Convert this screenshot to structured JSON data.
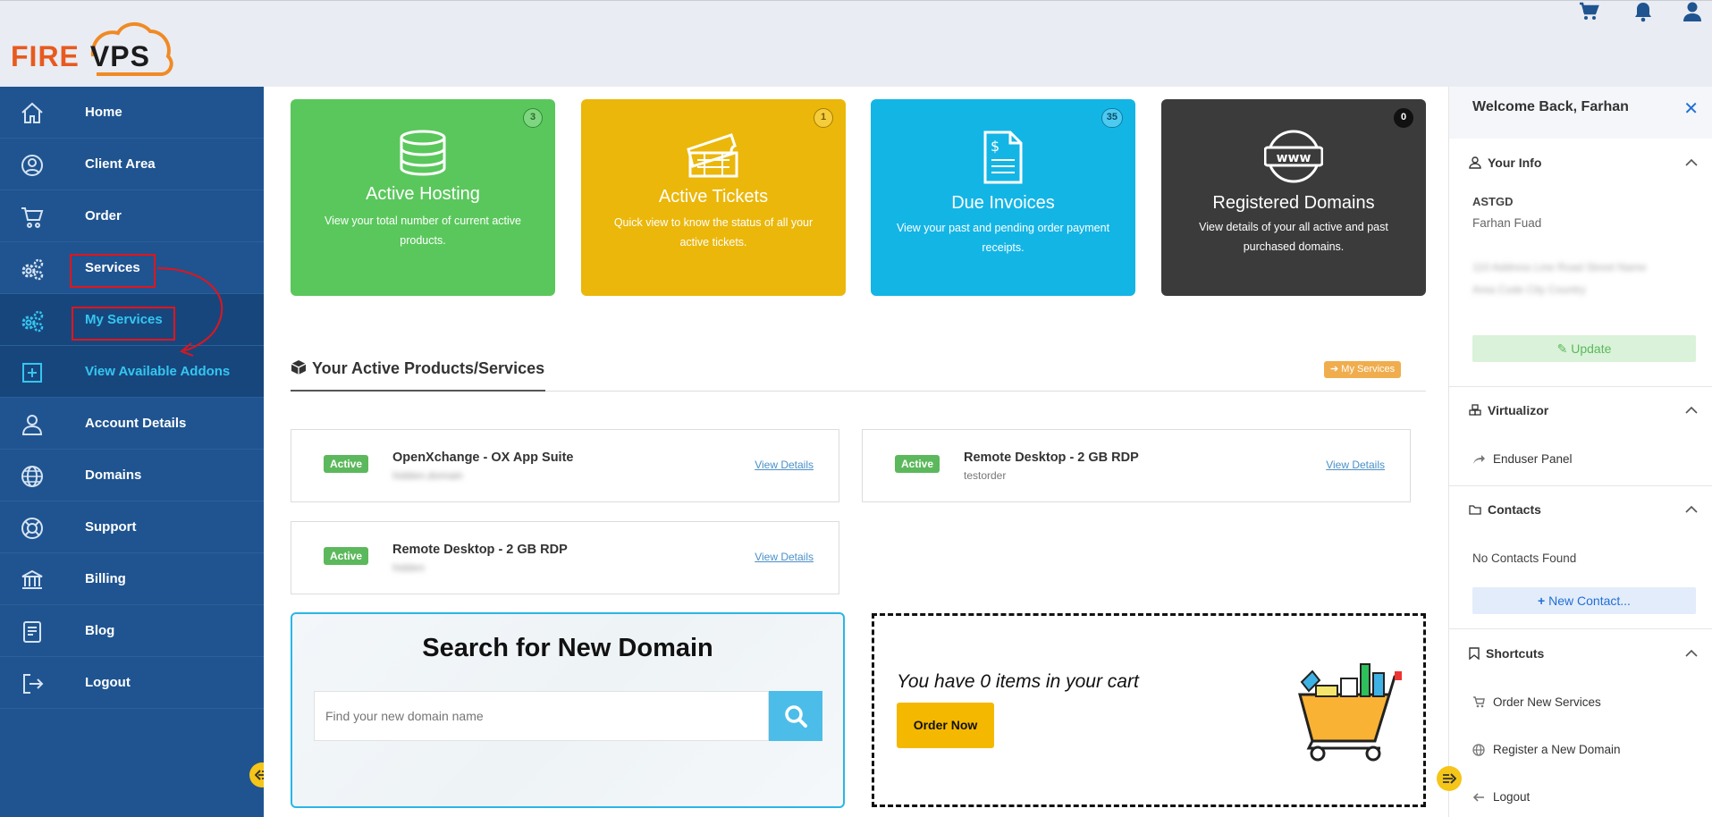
{
  "header": {
    "logo_fire": "FIRE",
    "logo_vps": "VPS",
    "icons": [
      "cart-icon",
      "bell-icon",
      "user-icon"
    ]
  },
  "sidebar": {
    "items": [
      {
        "label": "Home",
        "icon": "home-icon"
      },
      {
        "label": "Client Area",
        "icon": "user-circle-icon"
      },
      {
        "label": "Order",
        "icon": "cart-icon"
      },
      {
        "label": "Services",
        "icon": "gears-icon"
      },
      {
        "label": "My Services",
        "icon": "gears-icon"
      },
      {
        "label": "View Available Addons",
        "icon": "plus-square-icon"
      },
      {
        "label": "Account Details",
        "icon": "user-icon"
      },
      {
        "label": "Domains",
        "icon": "globe-icon"
      },
      {
        "label": "Support",
        "icon": "lifebuoy-icon"
      },
      {
        "label": "Billing",
        "icon": "bank-icon"
      },
      {
        "label": "Blog",
        "icon": "book-icon"
      },
      {
        "label": "Logout",
        "icon": "logout-icon"
      }
    ]
  },
  "tiles": [
    {
      "title": "Active Hosting",
      "count": "3",
      "desc": "View your total number of current active products.",
      "color": "#5ac75c"
    },
    {
      "title": "Active Tickets",
      "count": "1",
      "desc": "Quick view to know the  status of all your active tickets.",
      "color": "#ebb70a"
    },
    {
      "title": "Due Invoices",
      "count": "35",
      "desc": "View your past and pending order payment receipts.",
      "color": "#13b5e5"
    },
    {
      "title": "Registered Domains",
      "count": "0",
      "desc": "View details of your all active and past purchased domains.",
      "color": "#3b3b3b"
    }
  ],
  "products": {
    "title": "Your Active Products/Services",
    "my_services_btn": "My Services",
    "items": [
      {
        "status": "Active",
        "name": "OpenXchange - OX App Suite",
        "sub": "",
        "link": "View Details"
      },
      {
        "status": "Active",
        "name": "Remote Desktop - 2 GB RDP",
        "sub": "testorder",
        "link": "View Details"
      },
      {
        "status": "Active",
        "name": "Remote Desktop - 2 GB RDP",
        "sub": "",
        "link": "View Details"
      }
    ]
  },
  "domain_search": {
    "title": "Search for New Domain",
    "placeholder": "Find your new domain name"
  },
  "cart": {
    "text": "You have 0 items in your cart",
    "button": "Order Now"
  },
  "right_panel": {
    "welcome": "Welcome Back, Farhan",
    "your_info": {
      "heading": "Your Info",
      "company": "ASTGD",
      "name": "Farhan Fuad",
      "update_btn": "Update"
    },
    "virtualizor": {
      "heading": "Virtualizor",
      "link": "Enduser Panel"
    },
    "contacts": {
      "heading": "Contacts",
      "empty": "No Contacts Found",
      "new_btn": "New Contact..."
    },
    "shortcuts": {
      "heading": "Shortcuts",
      "links": [
        "Order New Services",
        "Register a New Domain",
        "Logout"
      ]
    }
  }
}
